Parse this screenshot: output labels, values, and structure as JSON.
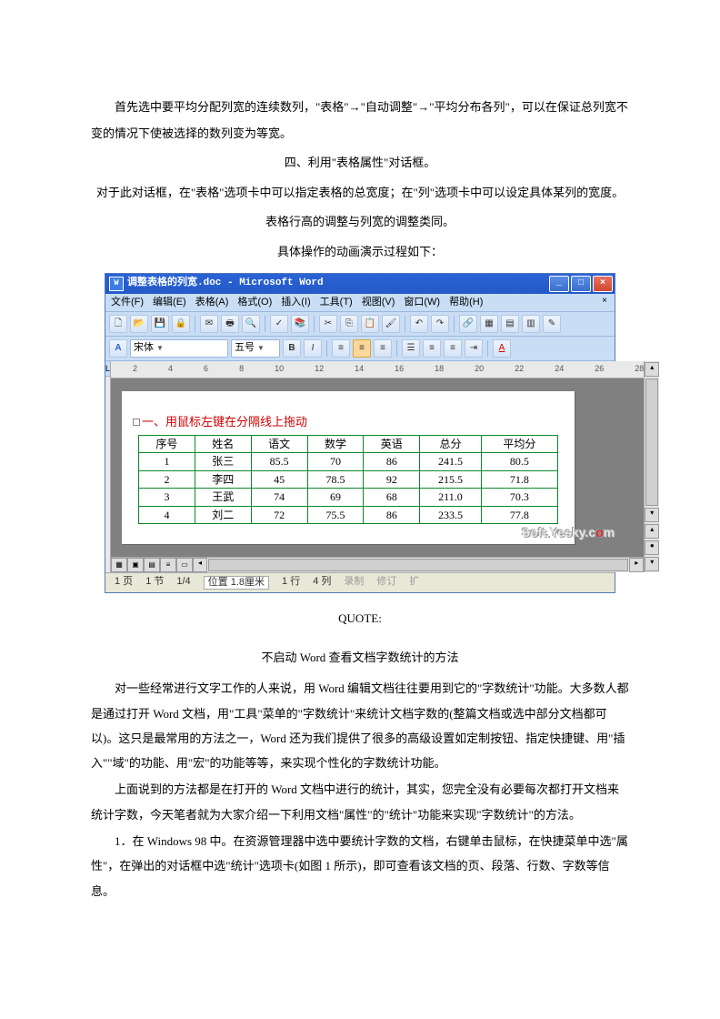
{
  "intro": {
    "p1": "首先选中要平均分配列宽的连续数列，\"表格\"→\"自动调整\"→\"平均分布各列\"，可以在保证总列宽不变的情况下使被选择的数列变为等宽。",
    "h4": "四、利用\"表格属性\"对话框。",
    "p2": "对于此对话框，在\"表格\"选项卡中可以指定表格的总宽度；在\"列\"选项卡中可以设定具体某列的宽度。",
    "p3": "表格行高的调整与列宽的调整类同。",
    "p4": "具体操作的动画演示过程如下："
  },
  "word": {
    "title": "调整表格的列宽.doc - Microsoft Word",
    "menus": [
      "文件(F)",
      "编辑(E)",
      "表格(A)",
      "格式(O)",
      "插入(I)",
      "工具(T)",
      "视图(V)",
      "窗口(W)",
      "帮助(H)"
    ],
    "font_name": "宋体",
    "font_size": "五号",
    "ruler_marks": [
      "2",
      "4",
      "6",
      "8",
      "10",
      "12",
      "14",
      "16",
      "18",
      "20",
      "22",
      "24",
      "26",
      "28"
    ],
    "redline": "一、用鼠标左键在分隔线上拖动",
    "table": {
      "headers": [
        "序号",
        "姓名",
        "语文",
        "数学",
        "英语",
        "总分",
        "平均分"
      ],
      "rows": [
        [
          "1",
          "张三",
          "85.5",
          "70",
          "86",
          "241.5",
          "80.5"
        ],
        [
          "2",
          "李四",
          "45",
          "78.5",
          "92",
          "215.5",
          "71.8"
        ],
        [
          "3",
          "王武",
          "74",
          "69",
          "68",
          "211.0",
          "70.3"
        ],
        [
          "4",
          "刘二",
          "72",
          "75.5",
          "86",
          "233.5",
          "77.8"
        ]
      ]
    },
    "watermark": {
      "a": "Soft.Yesky.c",
      "b": "o",
      "c": "m"
    },
    "status": {
      "page": "1 页",
      "sec": "1 节",
      "pages": "1/4",
      "pos": "位置 1.8厘米",
      "line": "1 行",
      "col": "4 列",
      "rec": "录制",
      "rev": "修订",
      "ext": "扩"
    }
  },
  "after": {
    "quote": "QUOTE:",
    "title": "不启动 Word 查看文档字数统计的方法",
    "p1": "对一些经常进行文字工作的人来说，用 Word 编辑文档往往要用到它的\"字数统计\"功能。大多数人都是通过打开 Word 文档，用\"工具\"菜单的\"字数统计\"来统计文档字数的(整篇文档或选中部分文档都可以)。这只是最常用的方法之一，Word 还为我们提供了很多的高级设置如定制按钮、指定快捷键、用\"插入\"\"域\"的功能、用\"宏\"的功能等等，来实现个性化的字数统计功能。",
    "p2": "上面说到的方法都是在打开的 Word 文档中进行的统计，其实，您完全没有必要每次都打开文档来统计字数，今天笔者就为大家介绍一下利用文档\"属性\"的\"统计\"功能来实现\"字数统计\"的方法。",
    "p3": "1．在 Windows 98 中。在资源管理器中选中要统计字数的文档，右键单击鼠标，在快捷菜单中选\"属性\"，在弹出的对话框中选\"统计\"选项卡(如图 1 所示)，即可查看该文档的页、段落、行数、字数等信息。"
  }
}
